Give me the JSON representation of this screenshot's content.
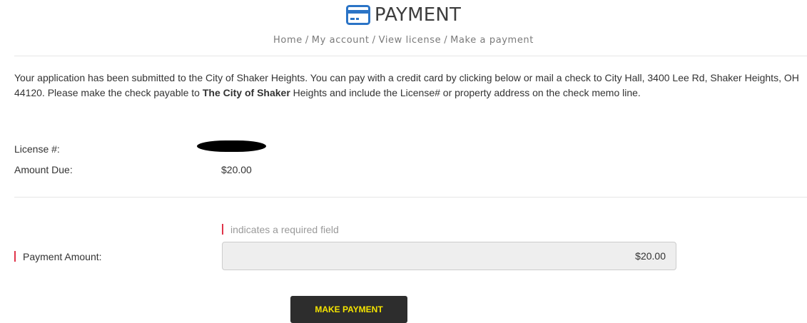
{
  "header": {
    "icon": "credit-card-icon",
    "title": "PAYMENT",
    "icon_color": "#2b74c6"
  },
  "breadcrumb": {
    "items": [
      "Home",
      "My account",
      "View license",
      "Make a payment"
    ],
    "separator": "/"
  },
  "intro": {
    "part1": "Your application has been submitted to the City of Shaker Heights. You can pay with a credit card by clicking below or mail a check to City Hall, 3400 Lee Rd, Shaker Heights, OH  44120. Please make the check payable to ",
    "bold": "The City of Shaker",
    "part2": " Heights and include the License# or property address on the check memo line."
  },
  "license": {
    "label": "License #:"
  },
  "amount_due": {
    "label": "Amount Due:",
    "value": "$20.00"
  },
  "form": {
    "required_note": "indicates a required field",
    "payment_amount_label": "Payment Amount:",
    "payment_amount_value": "$20.00",
    "submit_label": "MAKE PAYMENT"
  },
  "colors": {
    "required_marker": "#e0344a",
    "button_bg": "#2d2d2d",
    "button_text": "#f5e400"
  }
}
